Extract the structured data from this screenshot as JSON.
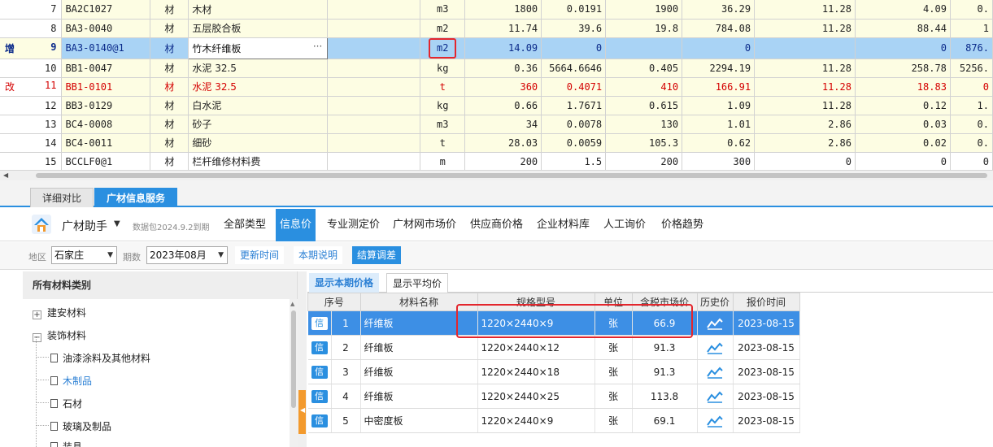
{
  "grid": {
    "rows": [
      {
        "idx": "7",
        "tag": "",
        "code": "BA2C1027",
        "kind": "材",
        "name": "木材",
        "spec": "",
        "unit": "m3",
        "c1": "1800",
        "c2": "0.0191",
        "c3": "1900",
        "c4": "36.29",
        "c5": "11.28",
        "c6": "4.09",
        "c7": "0."
      },
      {
        "idx": "8",
        "tag": "",
        "code": "BA3-0040",
        "kind": "材",
        "name": "五层胶合板",
        "spec": "",
        "unit": "m2",
        "c1": "11.74",
        "c2": "39.6",
        "c3": "19.8",
        "c4": "784.08",
        "c5": "11.28",
        "c6": "88.44",
        "c7": "1"
      },
      {
        "idx": "9",
        "tag": "增",
        "code": "BA3-0140@1",
        "kind": "材",
        "name": "竹木纤维板",
        "spec": "",
        "unit": "m2",
        "c1": "14.09",
        "c2": "0",
        "c3": "",
        "c4": "0",
        "c5": "",
        "c6": "0",
        "c7": "876."
      },
      {
        "idx": "10",
        "tag": "",
        "code": "BB1-0047",
        "kind": "材",
        "name": "水泥 32.5",
        "spec": "",
        "unit": "kg",
        "c1": "0.36",
        "c2": "5664.6646",
        "c3": "0.405",
        "c4": "2294.19",
        "c5": "11.28",
        "c6": "258.78",
        "c7": "5256."
      },
      {
        "idx": "11",
        "tag": "改",
        "code": "BB1-0101",
        "kind": "材",
        "name": "水泥 32.5",
        "spec": "",
        "unit": "t",
        "c1": "360",
        "c2": "0.4071",
        "c3": "410",
        "c4": "166.91",
        "c5": "11.28",
        "c6": "18.83",
        "c7": "0"
      },
      {
        "idx": "12",
        "tag": "",
        "code": "BB3-0129",
        "kind": "材",
        "name": "白水泥",
        "spec": "",
        "unit": "kg",
        "c1": "0.66",
        "c2": "1.7671",
        "c3": "0.615",
        "c4": "1.09",
        "c5": "11.28",
        "c6": "0.12",
        "c7": "1."
      },
      {
        "idx": "13",
        "tag": "",
        "code": "BC4-0008",
        "kind": "材",
        "name": "砂子",
        "spec": "",
        "unit": "m3",
        "c1": "34",
        "c2": "0.0078",
        "c3": "130",
        "c4": "1.01",
        "c5": "2.86",
        "c6": "0.03",
        "c7": "0."
      },
      {
        "idx": "14",
        "tag": "",
        "code": "BC4-0011",
        "kind": "材",
        "name": "细砂",
        "spec": "",
        "unit": "t",
        "c1": "28.03",
        "c2": "0.0059",
        "c3": "105.3",
        "c4": "0.62",
        "c5": "2.86",
        "c6": "0.02",
        "c7": "0."
      },
      {
        "idx": "15",
        "tag": "",
        "code": "BCCLF0@1",
        "kind": "材",
        "name": "栏杆维修材料费",
        "spec": "",
        "unit": "m",
        "c1": "200",
        "c2": "1.5",
        "c3": "200",
        "c4": "300",
        "c5": "0",
        "c6": "0",
        "c7": "0"
      }
    ],
    "edit_dots": "···"
  },
  "bottom_tabs": [
    {
      "label": "详细对比"
    },
    {
      "label": "广材信息服务"
    }
  ],
  "assistant": {
    "name": "广材助手",
    "package": "数据包2024.9.2到期",
    "tabs": [
      {
        "label": "全部类型"
      },
      {
        "label": "信息价"
      },
      {
        "label": "专业测定价"
      },
      {
        "label": "广材网市场价"
      },
      {
        "label": "供应商价格"
      },
      {
        "label": "企业材料库"
      },
      {
        "label": "人工询价"
      },
      {
        "label": "价格趋势"
      }
    ]
  },
  "filters": {
    "region_label": "地区",
    "region_value": "石家庄",
    "period_label": "期数",
    "period_value": "2023年08月",
    "update_btn": "更新时间",
    "note_btn": "本期说明",
    "settle_btn": "结算调差"
  },
  "categories": {
    "title": "所有材料类别",
    "items": [
      {
        "label": "建安材料",
        "expander": "+"
      },
      {
        "label": "装饰材料",
        "expander": "−"
      },
      {
        "label": "油漆涂料及其他材料"
      },
      {
        "label": "木制品"
      },
      {
        "label": "石材"
      },
      {
        "label": "玻璃及制品"
      },
      {
        "label": "装具"
      }
    ]
  },
  "price_view": {
    "tab_current": "显示本期价格",
    "tab_avg": "显示平均价",
    "headers": {
      "no": "序号",
      "name": "材料名称",
      "spec": "规格型号",
      "unit": "单位",
      "price": "含税市场价",
      "history": "历史价",
      "date": "报价时间"
    },
    "badge": "信",
    "rows": [
      {
        "no": "1",
        "name": "纤维板",
        "spec": "1220×2440×9",
        "unit": "张",
        "price": "66.9",
        "date": "2023-08-15"
      },
      {
        "no": "2",
        "name": "纤维板",
        "spec": "1220×2440×12",
        "unit": "张",
        "price": "91.3",
        "date": "2023-08-15"
      },
      {
        "no": "3",
        "name": "纤维板",
        "spec": "1220×2440×18",
        "unit": "张",
        "price": "91.3",
        "date": "2023-08-15"
      },
      {
        "no": "4",
        "name": "纤维板",
        "spec": "1220×2440×25",
        "unit": "张",
        "price": "113.8",
        "date": "2023-08-15"
      },
      {
        "no": "5",
        "name": "中密度板",
        "spec": "1220×2440×9",
        "unit": "张",
        "price": "69.1",
        "date": "2023-08-15"
      }
    ]
  },
  "colors": {
    "accent": "#2a8fe0",
    "highlight": "#e3262d",
    "selected_row": "#a9d3f5",
    "grid_bg": "#fdfde3",
    "modified_text": "#d40000"
  }
}
